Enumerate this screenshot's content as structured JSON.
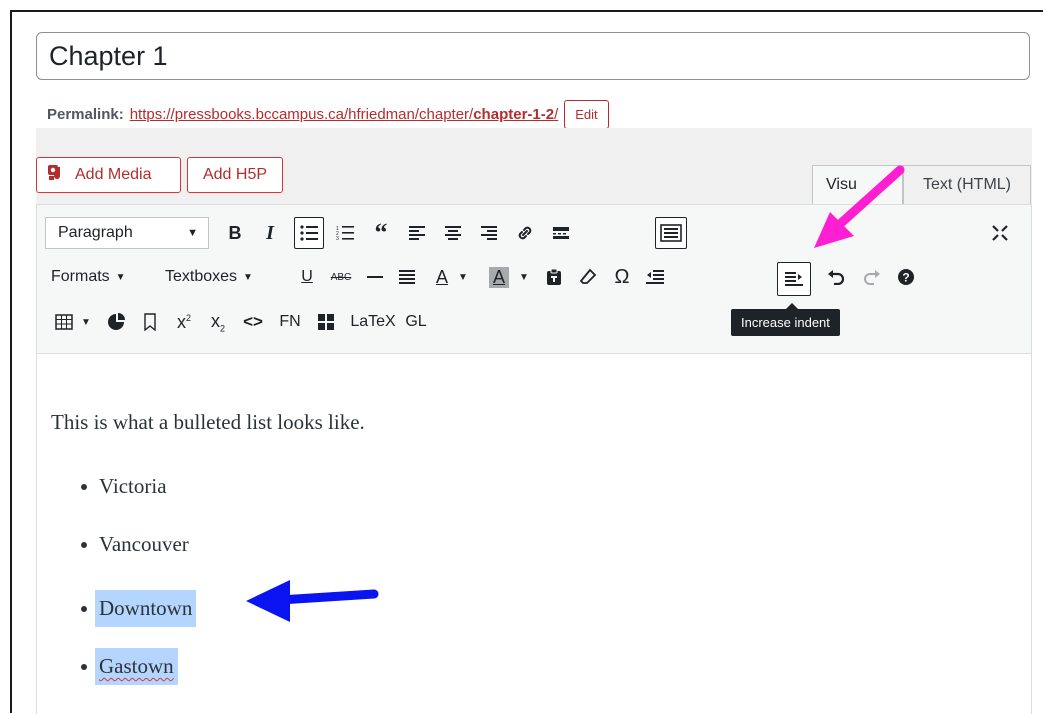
{
  "post": {
    "title": "Chapter 1",
    "permalink_label": "Permalink:",
    "permalink_base": "https://pressbooks.bccampus.ca/hfriedman/chapter/",
    "permalink_slug": "chapter-1-2",
    "permalink_tail": "/",
    "edit_label": "Edit"
  },
  "media_buttons": {
    "add_media": "Add Media",
    "add_h5p": "Add H5P"
  },
  "tabs": {
    "visual": "Visu",
    "text": "Text (HTML)"
  },
  "toolbar": {
    "format_select": "Paragraph",
    "formats": "Formats",
    "textboxes": "Textboxes",
    "footnote": "FN",
    "latex": "LaTeX",
    "glossary": "GL",
    "tooltip": "Increase indent"
  },
  "content": {
    "intro": "This is what a bulleted list looks like.",
    "list": [
      "Victoria",
      "Vancouver",
      "Downtown",
      "Gastown"
    ]
  },
  "colors": {
    "accent": "#b32d2e",
    "annotation_pink": "#ff1fd2",
    "annotation_blue": "#0a14f0",
    "selection": "#b4d5fe"
  }
}
